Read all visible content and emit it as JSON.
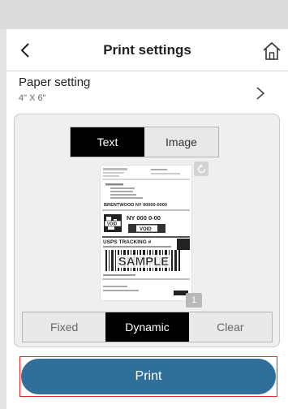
{
  "header": {
    "title": "Print settings"
  },
  "paper": {
    "label": "Paper setting",
    "size": "4\" X 6\""
  },
  "content_toggle": {
    "options": [
      "Text",
      "Image"
    ],
    "selected": "Text"
  },
  "preview": {
    "page_number": "1",
    "label": {
      "ship_to_city": "BRENTWOOD NY 00000-0000",
      "service_code": "NY 000 0-00",
      "void_stamp": "VOID",
      "tracking_heading": "USPS TRACKING #",
      "watermark": "SAMPLE"
    }
  },
  "mode_toggle": {
    "options": [
      "Fixed",
      "Dynamic",
      "Clear"
    ],
    "selected": "Dynamic"
  },
  "actions": {
    "print_label": "Print"
  },
  "colors": {
    "accent": "#2f6f9a",
    "highlight_border": "#e52727",
    "segment_active": "#000000"
  },
  "icons": {
    "back": "chevron-left-icon",
    "home": "home-icon",
    "paper_next": "chevron-right-icon",
    "rotate": "rotate-icon"
  }
}
